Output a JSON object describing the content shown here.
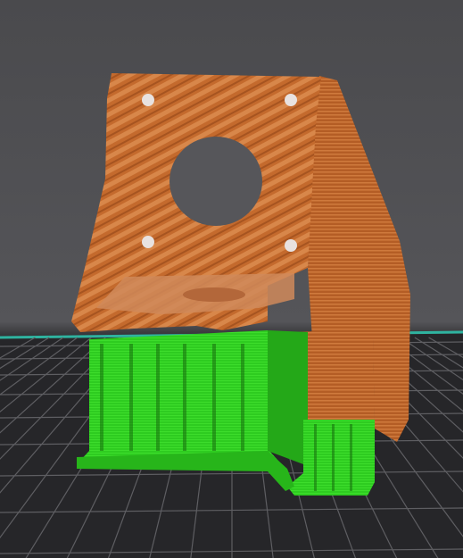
{
  "viewport": {
    "background_color": "#4d4d50",
    "bed_color": "#2a2a2d",
    "bed_grid_color": "#5e5e62",
    "bed_edge_color": "#2fb3a0"
  },
  "model": {
    "print_color": "#c86a2e",
    "print_highlight": "#e39154",
    "print_shadow": "#8e4419",
    "support_color": "#2ecc20",
    "support_shadow": "#1f8f14",
    "support_dark": "#176d0e"
  }
}
